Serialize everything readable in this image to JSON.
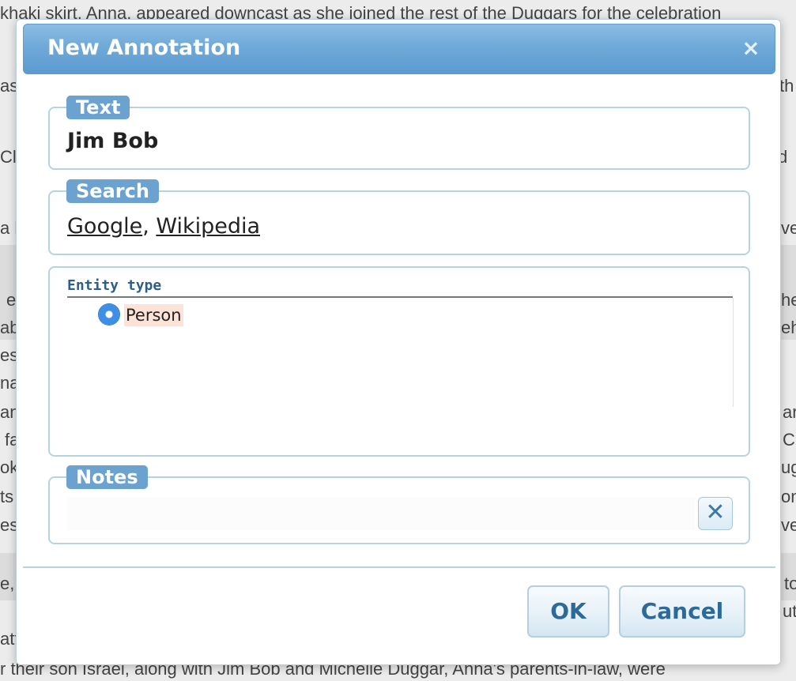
{
  "background": {
    "lines": [
      "khaki skirt,  Anna,  appeared downcast as she joined the rest of the Duggars for the celebration",
      "as",
      "Cl",
      "a le",
      "e",
      "ab",
      "est",
      "na",
      "and",
      "fa",
      "ok",
      "ts",
      "es",
      "e,",
      "att",
      "r their son Israel,   along with  Jim Bob and Michelle Duggar, Anna's parents-in-law, were"
    ],
    "right_fragments": [
      "th",
      "d",
      "ve",
      "he",
      "eh",
      "ar",
      "C",
      "ug",
      "on",
      "ve",
      "to",
      "ut"
    ]
  },
  "dialog": {
    "title": "New Annotation",
    "close_label": "×",
    "text_box": {
      "legend": "Text",
      "value": "Jim Bob"
    },
    "search_box": {
      "legend": "Search",
      "links": [
        "Google",
        "Wikipedia"
      ],
      "separator": ", "
    },
    "entity_box": {
      "header": "Entity type",
      "options": [
        {
          "label": "Person",
          "selected": true
        }
      ]
    },
    "notes_box": {
      "legend": "Notes",
      "value": "",
      "clear_label": "✕"
    },
    "buttons": {
      "ok": "OK",
      "cancel": "Cancel"
    }
  },
  "colors": {
    "title_bar": "#6fa9d8",
    "legend_bg": "#6ba2cf",
    "accent_text": "#2b6a99",
    "selection_highlight": "#fde3d7"
  }
}
